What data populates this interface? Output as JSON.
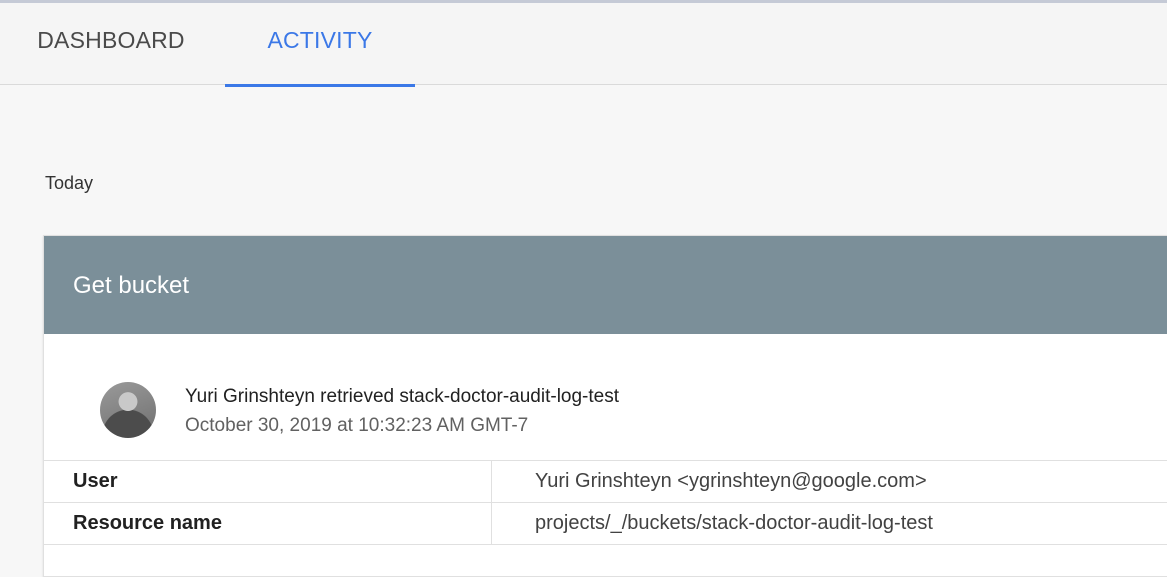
{
  "tabs": {
    "dashboard_label": "DASHBOARD",
    "activity_label": "ACTIVITY"
  },
  "activity": {
    "day_label": "Today",
    "card": {
      "title": "Get bucket",
      "summary": "Yuri Grinshteyn retrieved stack-doctor-audit-log-test",
      "timestamp": "October 30, 2019 at 10:32:23 AM GMT-7",
      "details": [
        {
          "label": "User",
          "value": "Yuri Grinshteyn <ygrinshteyn@google.com>"
        },
        {
          "label": "Resource name",
          "value": "projects/_/buckets/stack-doctor-audit-log-test"
        }
      ]
    }
  },
  "colors": {
    "accent": "#3b78e7",
    "card_header": "#7b8f99",
    "background": "#f7f7f7"
  }
}
